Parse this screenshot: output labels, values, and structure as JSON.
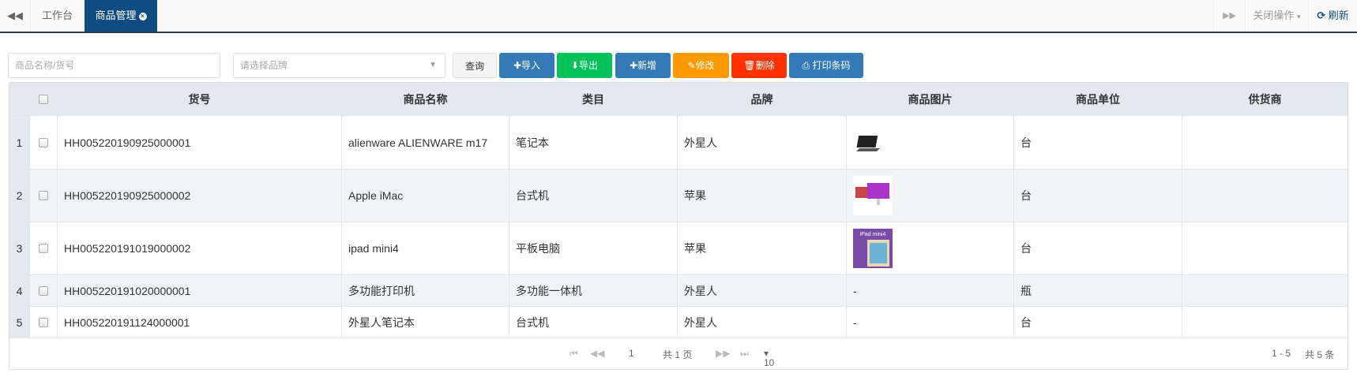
{
  "tabbar": {
    "tabs": [
      {
        "label": "工作台"
      },
      {
        "label": "商品管理"
      }
    ],
    "close_ops": "关闭操作",
    "refresh": "刷新"
  },
  "toolbar": {
    "search_placeholder": "商品名称/货号",
    "brand_placeholder": "请选择品牌",
    "query": "查询",
    "import": "导入",
    "export": "导出",
    "add": "新增",
    "edit": "修改",
    "delete": "删除",
    "print": "打印条码"
  },
  "colors": {
    "blue": "#337ab7",
    "green": "#00c259",
    "orange": "#ff9900",
    "red": "#ff3300",
    "tab": "#0f4c81"
  },
  "table": {
    "headers": [
      "货号",
      "商品名称",
      "类目",
      "品牌",
      "商品图片",
      "商品单位",
      "供货商"
    ],
    "rows": [
      {
        "n": "1",
        "code": "HH005220190925000001",
        "name": "alienware ALIENWARE m17",
        "cat": "笔记本",
        "brand": "外星人",
        "img": "laptop",
        "unit": "台",
        "supplier": ""
      },
      {
        "n": "2",
        "code": "HH005220190925000002",
        "name": "Apple iMac",
        "cat": "台式机",
        "brand": "苹果",
        "img": "imac",
        "unit": "台",
        "supplier": ""
      },
      {
        "n": "3",
        "code": "HH005220191019000002",
        "name": "ipad mini4",
        "cat": "平板电脑",
        "brand": "苹果",
        "img": "ipad",
        "img_text": "iPad mini4",
        "unit": "台",
        "supplier": ""
      },
      {
        "n": "4",
        "code": "HH005220191020000001",
        "name": "多功能打印机",
        "cat": "多功能一体机",
        "brand": "外星人",
        "img_text": "-",
        "unit": "瓶",
        "supplier": ""
      },
      {
        "n": "5",
        "code": "HH005220191124000001",
        "name": "外星人笔记本",
        "cat": "台式机",
        "brand": "外星人",
        "img_text": "-",
        "unit": "台",
        "supplier": ""
      }
    ]
  },
  "pagination": {
    "page": "1",
    "total_pages": "共 1 页",
    "page_size": "10",
    "range": "1 - 5",
    "total": "共 5 条"
  }
}
